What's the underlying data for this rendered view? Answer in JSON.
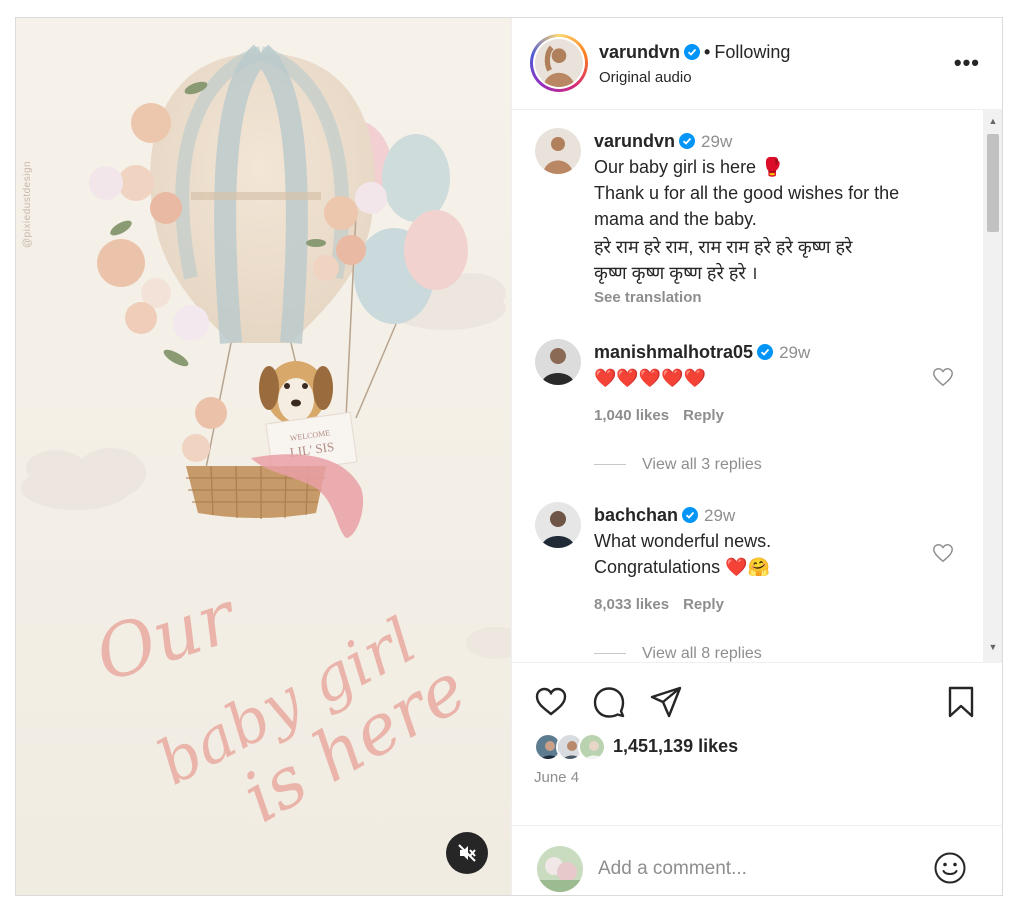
{
  "media": {
    "watermark": "@pixiedustdesign",
    "sign_text": [
      "WELCOME",
      "LIL' SIS"
    ],
    "script_lines": [
      "Our",
      "baby girl",
      "is here"
    ],
    "mute_icon": "speaker-muted-icon"
  },
  "header": {
    "username": "varundvn",
    "dot": "•",
    "follow_status": "Following",
    "subtitle": "Original audio",
    "more_icon": "more-options-icon",
    "more_glyph": "•••"
  },
  "caption": {
    "username": "varundvn",
    "time": "29w",
    "lines": [
      "Our baby girl is here 🥊",
      "Thank u for all the good wishes for the",
      "mama and the baby.",
      "हरे राम हरे राम, राम राम हरे हरे कृष्ण हरे",
      "कृष्ण कृष्ण कृष्ण हरे हरे ।"
    ],
    "see_translation": "See translation"
  },
  "comments": [
    {
      "username": "manishmalhotra05",
      "time": "29w",
      "lines": [
        "❤️❤️❤️❤️❤️"
      ],
      "likes": "1,040 likes",
      "reply": "Reply",
      "view_replies": "View all 3 replies"
    },
    {
      "username": "bachchan",
      "time": "29w",
      "lines": [
        "What wonderful news.",
        "Congratulations ❤️🤗"
      ],
      "likes": "8,033 likes",
      "reply": "Reply",
      "view_replies": "View all 8 replies"
    }
  ],
  "actions": {
    "icons": [
      "heart-icon",
      "comment-icon",
      "share-icon",
      "bookmark-icon"
    ],
    "likes": "1,451,139 likes",
    "date": "June 4",
    "add_comment_placeholder": "Add a comment...",
    "emoji_icon": "emoji-smile-icon"
  },
  "colors": {
    "verified": "#0095f6",
    "muted_text": "#8e8e8e",
    "border": "#dbdbdb",
    "script_pink": "#eab4aa"
  }
}
